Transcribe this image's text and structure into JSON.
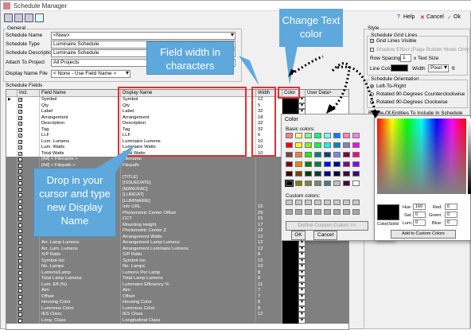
{
  "window": {
    "title": "Schedule Manager"
  },
  "toolbar": {
    "help": "Help",
    "cancel": "Cancel",
    "ok": "Ok"
  },
  "general": {
    "title": "General",
    "schedule_name_label": "Schedule Name",
    "schedule_name_value": "<New>",
    "schedule_type_label": "Schedule Type",
    "schedule_type_value": "Luminaire Schedule",
    "schedule_desc_label": "Schedule Description",
    "schedule_desc_value": "Luminaire Schedule",
    "attach_label": "Attach To Project",
    "attach_value": "All Projects",
    "display_file_label": "Display Name File",
    "display_file_value": "< None - Use Field Name >"
  },
  "fields": {
    "title": "Schedule Fields",
    "headers": [
      "Incl.",
      "Field Name",
      "Display Name",
      "Width",
      "Color",
      "User Data>"
    ],
    "rows": [
      {
        "incl": true,
        "field": "Symbol",
        "display": "Symbol",
        "width": "12",
        "gray": false,
        "arrow": true
      },
      {
        "incl": true,
        "field": "Qty",
        "display": "Qty",
        "width": "5",
        "gray": false
      },
      {
        "incl": true,
        "field": "Label",
        "display": "Label",
        "width": "32",
        "gray": false
      },
      {
        "incl": true,
        "field": "Arrangement",
        "display": "Arrangement",
        "width": "18",
        "gray": false
      },
      {
        "incl": true,
        "field": "Description",
        "display": "Description",
        "width": "32",
        "gray": false
      },
      {
        "incl": true,
        "field": "Tag",
        "display": "Tag",
        "width": "32",
        "gray": false
      },
      {
        "incl": true,
        "field": "LLF",
        "display": "LLF",
        "width": "6",
        "gray": false
      },
      {
        "incl": true,
        "field": "Lum. Lumens",
        "display": "Luminaire Lumens",
        "width": "10",
        "gray": false
      },
      {
        "incl": true,
        "field": "Lum. Watts",
        "display": "Luminaire Watts",
        "width": "10",
        "gray": false
      },
      {
        "incl": true,
        "field": "Total Watts",
        "display": "Total Watts",
        "width": "10",
        "gray": false
      },
      {
        "incl": false,
        "field": "[Att] < Filename >",
        "display": "Filename",
        "width": "",
        "gray": true
      },
      {
        "incl": false,
        "field": "[Att] < Filepath >",
        "display": "Filepath",
        "width": "",
        "gray": true
      },
      {
        "incl": false,
        "field": "",
        "display": "",
        "width": "",
        "gray": true
      },
      {
        "incl": false,
        "field": "",
        "display": "[TITLE]",
        "width": "",
        "gray": true
      },
      {
        "incl": false,
        "field": "",
        "display": "[ISSUEDATE]",
        "width": "",
        "gray": true
      },
      {
        "incl": false,
        "field": "",
        "display": "[MANUFAC]",
        "width": "",
        "gray": true
      },
      {
        "incl": false,
        "field": "",
        "display": "[LUMCAT]",
        "width": "",
        "gray": true
      },
      {
        "incl": false,
        "field": "",
        "display": "[LUMINAIRE]",
        "width": "",
        "gray": true
      },
      {
        "incl": false,
        "field": "",
        "display": "Info URL",
        "width": "15",
        "gray": true
      },
      {
        "incl": false,
        "field": "",
        "display": "Photometric Center Offset",
        "width": "29",
        "gray": true
      },
      {
        "incl": false,
        "field": "",
        "display": "CCT",
        "width": "15",
        "gray": true
      },
      {
        "incl": false,
        "field": "",
        "display": "Mounting Height",
        "width": "17",
        "gray": true
      },
      {
        "incl": false,
        "field": "",
        "display": "Photometric Center Z",
        "width": "22",
        "gray": true
      },
      {
        "incl": false,
        "field": "",
        "display": "Arrangement Watts",
        "width": "12",
        "gray": true
      },
      {
        "incl": false,
        "field": "Arr. Lamp Lumens",
        "display": "Arrangement Lamp Lumens",
        "width": "12",
        "gray": true
      },
      {
        "incl": false,
        "field": "Arr. Lum. Lumens",
        "display": "Arrangement Luminaire Lumens",
        "width": "12",
        "gray": true
      },
      {
        "incl": false,
        "field": "S/P Ratio",
        "display": "S/P Ratio",
        "width": "8",
        "gray": true
      },
      {
        "incl": false,
        "field": "Symbol-Iso",
        "display": "Symbol-Iso",
        "width": "12",
        "gray": true
      },
      {
        "incl": false,
        "field": "No. Lamps",
        "display": "No. Lamps",
        "width": "10",
        "gray": true
      },
      {
        "incl": false,
        "field": "Lumens/Lamp",
        "display": "Lumens Per Lamp",
        "width": "8",
        "gray": true
      },
      {
        "incl": false,
        "field": "Total Lamp Lumens",
        "display": "Total Lamp Lumens",
        "width": "8",
        "gray": true
      },
      {
        "incl": false,
        "field": "Lum. Eff (%)",
        "display": "Luminaire Efficiency %",
        "width": "11",
        "gray": true
      },
      {
        "incl": false,
        "field": "Aim",
        "display": "Aim",
        "width": "7",
        "gray": true
      },
      {
        "incl": false,
        "field": "Offset",
        "display": "Offset",
        "width": "7",
        "gray": true
      },
      {
        "incl": false,
        "field": "Housing Color",
        "display": "Housing Color",
        "width": "8",
        "gray": true
      },
      {
        "incl": false,
        "field": "Luminous Color",
        "display": "Luminous Color",
        "width": "8",
        "gray": true
      },
      {
        "incl": false,
        "field": "IES Class",
        "display": "IES Class",
        "width": "12",
        "gray": true
      },
      {
        "incl": false,
        "field": "Long. Class",
        "display": "Longitudinal Class",
        "width": "",
        "gray": true
      }
    ]
  },
  "style": {
    "title": "Style",
    "grid_lines_title": "Schedule Grid Lines",
    "lines_visible": "Grid Lines Visible",
    "shadow_effect": "Shadow Effect (Page Builder Mode Only)",
    "row_spacing_label": "Row Spacing",
    "row_spacing_value": "1",
    "row_spacing_unit": "x Text Size",
    "line_color_label": "Line Color",
    "width_label": "Width",
    "width_unit": "Pixel",
    "width_suffix": "ft",
    "orientation_title": "Schedule Orientation",
    "left_to_right": "Left-To-Right",
    "rot_ccw": "Rotated 90-Degrees Counterclockwise",
    "rot_cw": "Rotated 90-Degrees Clockwise",
    "range_title": "Range Of Entities To Include In Schedule"
  },
  "color_dialog_small": {
    "title": "Color",
    "basic": "Basic colors:",
    "custom": "Custom colors:",
    "define": "Define Custom Colors >>",
    "ok": "OK",
    "cancel": "Cancel"
  },
  "color_picker": {
    "solid": "Color|Solid",
    "hue_label": "Hue:",
    "hue": "160",
    "sat_label": "Sat:",
    "sat": "0",
    "lum_label": "Lum:",
    "lum": "0",
    "red_label": "Red:",
    "red": "0",
    "green_label": "Green:",
    "green": "0",
    "blue_label": "Blue:",
    "blue": "0",
    "add": "Add to Custom Colors"
  },
  "callouts": {
    "change_color": "Change Text color",
    "field_width": "Field width in characters",
    "drop_in": "Drop in your cursor and type new Display Name"
  },
  "colors": {
    "callout": "#5ea8dc",
    "red_box": "#e03030"
  }
}
